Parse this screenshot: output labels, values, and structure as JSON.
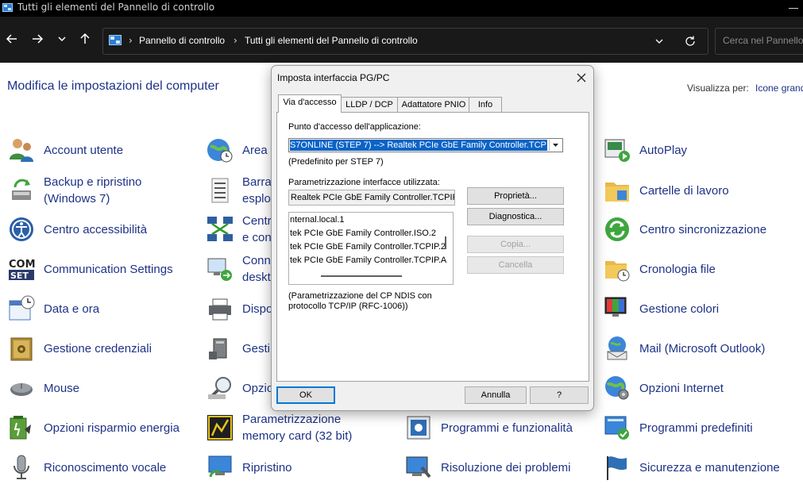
{
  "window": {
    "title": "Tutti gli elementi del Pannello di controllo"
  },
  "address_bar": {
    "breadcrumbs": [
      "Pannello di controllo",
      "Tutti gli elementi del Pannello di controllo"
    ],
    "separator": "›",
    "search_placeholder": "Cerca nel Pannello"
  },
  "header": {
    "title": "Modifica le impostazioni del computer",
    "view_label": "Visualizza per:",
    "view_value": "Icone grandi"
  },
  "items": {
    "col1": [
      {
        "label": "Account utente",
        "icon": "users-icon"
      },
      {
        "label": "Backup e ripristino\n(Windows 7)",
        "icon": "backup-icon"
      },
      {
        "label": "Centro accessibilità",
        "icon": "accessibility-icon"
      },
      {
        "label": "Communication Settings",
        "icon": "com-set-icon"
      },
      {
        "label": "Data e ora",
        "icon": "calendar-clock-icon"
      },
      {
        "label": "Gestione credenziali",
        "icon": "credential-vault-icon"
      },
      {
        "label": "Mouse",
        "icon": "mouse-icon"
      },
      {
        "label": "Opzioni risparmio energia",
        "icon": "power-options-icon"
      },
      {
        "label": "Riconoscimento vocale",
        "icon": "microphone-icon"
      }
    ],
    "col2": [
      {
        "label": "Area",
        "icon": "globe-clock-icon"
      },
      {
        "label": "Barra\nesplo",
        "icon": "taskbar-icon"
      },
      {
        "label": "Centr\ne con",
        "icon": "network-icon"
      },
      {
        "label": "Conn\ndeskt",
        "icon": "remote-desktop-icon"
      },
      {
        "label": "Dispo",
        "icon": "printer-icon"
      },
      {
        "label": "Gesti",
        "icon": "device-manager-icon"
      },
      {
        "label": "Opzio",
        "icon": "indexing-icon"
      },
      {
        "label": "Parametrizzazione\nmemory card (32 bit)",
        "icon": "memory-card-icon"
      },
      {
        "label": "Ripristino",
        "icon": "recovery-icon"
      }
    ],
    "col3": [
      {
        "label": "Programmi e funzionalità",
        "icon": "programs-icon"
      },
      {
        "label": "Risoluzione dei problemi",
        "icon": "troubleshoot-icon"
      }
    ],
    "col4": [
      {
        "label": "AutoPlay",
        "icon": "autoplay-icon"
      },
      {
        "label": "Cartelle di lavoro",
        "icon": "work-folders-icon"
      },
      {
        "label": "Centro sincronizzazione",
        "icon": "sync-icon"
      },
      {
        "label": "Cronologia file",
        "icon": "file-history-icon"
      },
      {
        "label": "Gestione colori",
        "icon": "color-management-icon"
      },
      {
        "label": "Mail (Microsoft Outlook)",
        "icon": "mail-icon"
      },
      {
        "label": "Opzioni Internet",
        "icon": "internet-options-icon"
      },
      {
        "label": "Programmi predefiniti",
        "icon": "default-programs-icon"
      },
      {
        "label": "Sicurezza e manutenzione",
        "icon": "flag-icon"
      }
    ]
  },
  "dialog": {
    "title": "Imposta interfaccia PG/PC",
    "tabs": [
      "Via d'accesso",
      "LLDP / DCP",
      "Adattatore PNIO",
      "Info"
    ],
    "access_point_label": "Punto d'accesso dell'applicazione:",
    "access_point_value": "S7ONLINE (STEP 7)      --> Realtek PCIe GbE Family Controller.TCP",
    "default_note": "(Predefinito per STEP 7)",
    "param_label": "Parametrizzazione interfacce utilizzata:",
    "param_value": "Realtek PCIe GbE Family Controller.TCPIP.",
    "list_items": [
      "nternal.local.1",
      "tek PCIe GbE Family Controller.ISO.2",
      "tek PCIe GbE Family Controller.TCPIP.2",
      "tek PCIe GbE Family Controller.TCPIP.A"
    ],
    "buttons": {
      "properties": "Proprietà...",
      "diagnostics": "Diagnostica...",
      "copy": "Copia...",
      "delete": "Cancella",
      "ok": "OK",
      "cancel": "Annulla",
      "help": "?"
    },
    "description_line1": "(Parametrizzazione del CP NDIS con",
    "description_line2": "protocollo TCP/IP (RFC-1006))"
  }
}
